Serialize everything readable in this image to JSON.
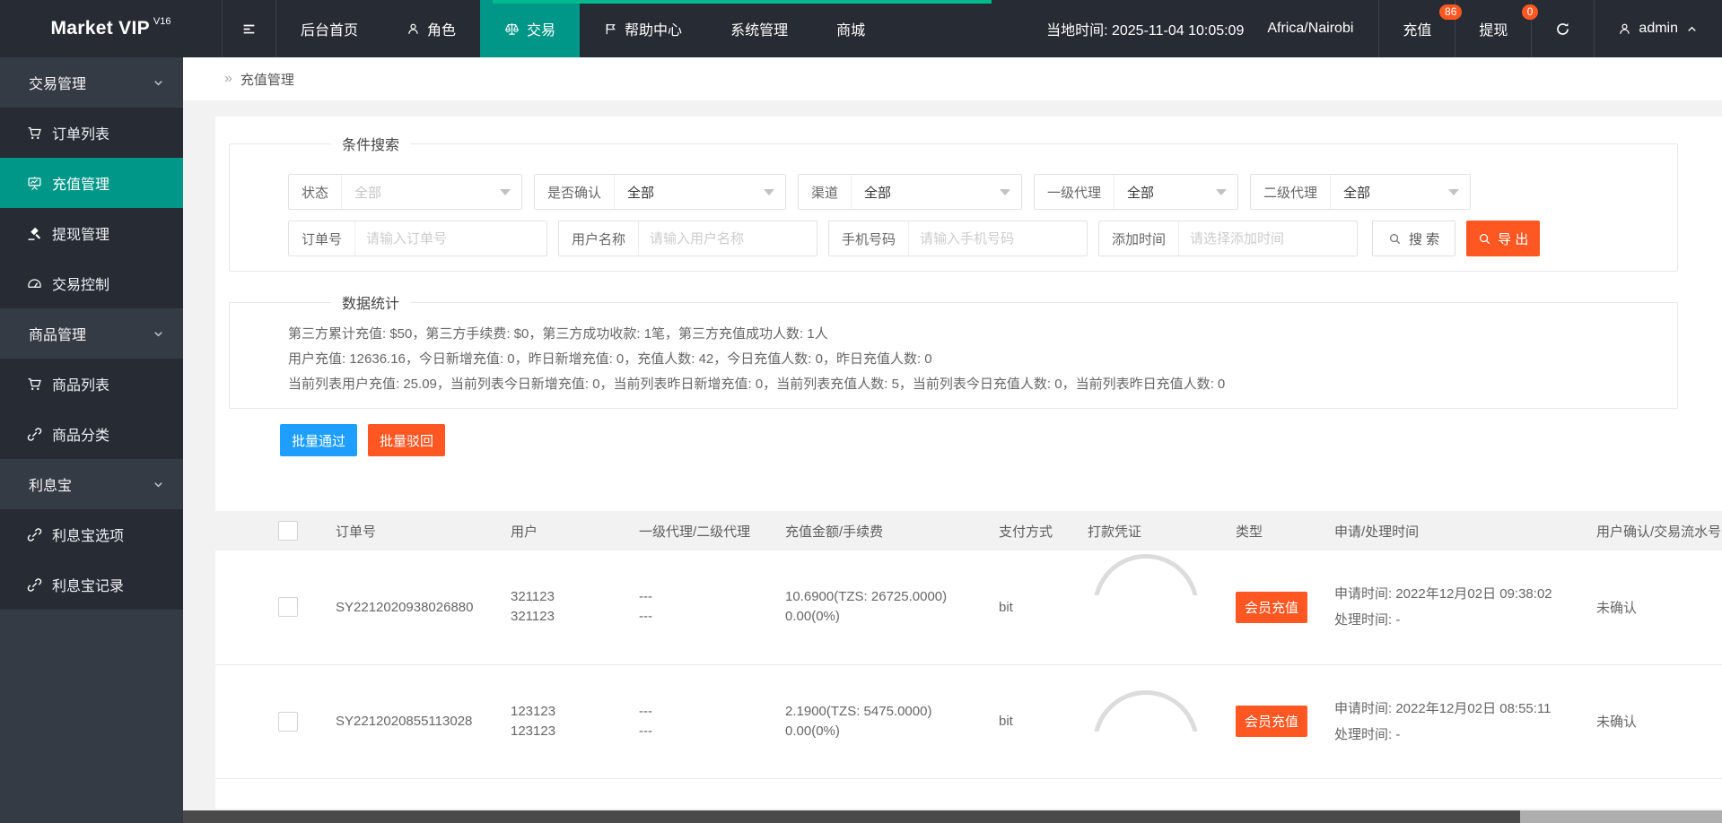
{
  "colors": {
    "accent_teal": "#009688",
    "accent_orange": "#FF5722",
    "accent_blue": "#1E9FFF",
    "badge_red": "#FF5722"
  },
  "topbar": {
    "brand": {
      "title": "Market VIP",
      "version": "V16"
    },
    "menu": [
      {
        "label": "后台首页",
        "icon": "none"
      },
      {
        "label": "角色",
        "icon": "user-icon"
      },
      {
        "label": "交易",
        "icon": "scale-icon",
        "active": true
      },
      {
        "label": "帮助中心",
        "icon": "flag-icon"
      },
      {
        "label": "系统管理",
        "icon": "none"
      },
      {
        "label": "商城",
        "icon": "none"
      }
    ],
    "local_time": "当地时间: 2025-11-04 10:05:09",
    "timezone": "Africa/Nairobi",
    "recharge": {
      "label": "充值",
      "badge": "86"
    },
    "withdraw": {
      "label": "提现",
      "badge": "0"
    },
    "user": {
      "name": "admin"
    }
  },
  "sidebar": {
    "groups": [
      {
        "label": "交易管理",
        "items": [
          {
            "label": "订单列表",
            "icon": "cart-icon"
          },
          {
            "label": "充值管理",
            "icon": "chart-board-icon",
            "active": true
          },
          {
            "label": "提现管理",
            "icon": "gavel-icon"
          },
          {
            "label": "交易控制",
            "icon": "gauge-icon"
          }
        ]
      },
      {
        "label": "商品管理",
        "items": [
          {
            "label": "商品列表",
            "icon": "cart-icon"
          },
          {
            "label": "商品分类",
            "icon": "link-icon"
          }
        ]
      },
      {
        "label": "利息宝",
        "items": [
          {
            "label": "利息宝选项",
            "icon": "link-icon"
          },
          {
            "label": "利息宝记录",
            "icon": "link-icon"
          }
        ]
      }
    ]
  },
  "breadcrumb": {
    "arrow": "»",
    "title": "充值管理"
  },
  "filters": {
    "legend": "条件搜索",
    "selects": [
      {
        "label": "状态",
        "value": "全部"
      },
      {
        "label": "是否确认",
        "value": "全部"
      },
      {
        "label": "渠道",
        "value": "全部"
      },
      {
        "label": "一级代理",
        "value": "全部"
      },
      {
        "label": "二级代理",
        "value": "全部"
      }
    ],
    "inputs": [
      {
        "label": "订单号",
        "placeholder": "请输入订单号"
      },
      {
        "label": "用户名称",
        "placeholder": "请输入用户名称"
      },
      {
        "label": "手机号码",
        "placeholder": "请输入手机号码"
      },
      {
        "label": "添加时间",
        "placeholder": "请选择添加时间"
      }
    ],
    "search_label": "搜 索",
    "export_label": "导 出"
  },
  "stats": {
    "legend": "数据统计",
    "lines": [
      "第三方累计充值: $50，第三方手续费: $0，第三方成功收款: 1笔，第三方充值成功人数: 1人",
      "用户充值: 12636.16，今日新增充值: 0，昨日新增充值: 0，充值人数: 42，今日充值人数: 0，昨日充值人数: 0",
      "当前列表用户充值: 25.09，当前列表今日新增充值: 0，当前列表昨日新增充值: 0，当前列表充值人数: 5，当前列表今日充值人数: 0，当前列表昨日充值人数: 0"
    ]
  },
  "actions": {
    "approve": "批量通过",
    "reject": "批量驳回"
  },
  "table": {
    "headers": [
      "订单号",
      "用户",
      "一级代理/二级代理",
      "充值金额/手续费",
      "支付方式",
      "打款凭证",
      "类型",
      "申请/处理时间",
      "用户确认/交易流水号"
    ],
    "rows": [
      {
        "order_no": "SY2212020938026880",
        "user_line1": "321123",
        "user_line2": "321123",
        "agent_line1": "---",
        "agent_line2": "---",
        "amount": "10.6900(TZS: 26725.0000)",
        "fee": "0.00(0%)",
        "pay_method": "bit",
        "type": "会员充值",
        "apply_time": "申请时间: 2022年12月02日 09:38:02",
        "process_time": "处理时间: -",
        "confirm": "未确认"
      },
      {
        "order_no": "SY2212020855113028",
        "user_line1": "123123",
        "user_line2": "123123",
        "agent_line1": "---",
        "agent_line2": "---",
        "amount": "2.1900(TZS: 5475.0000)",
        "fee": "0.00(0%)",
        "pay_method": "bit",
        "type": "会员充值",
        "apply_time": "申请时间: 2022年12月02日 08:55:11",
        "process_time": "处理时间: -",
        "confirm": "未确认"
      }
    ]
  }
}
